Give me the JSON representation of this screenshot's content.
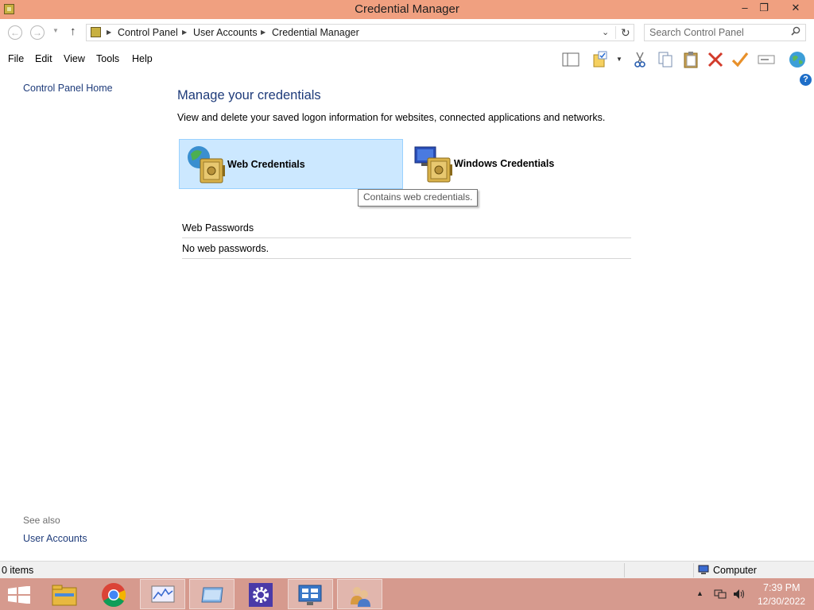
{
  "window": {
    "title": "Credential Manager"
  },
  "controls": {
    "minimize": "–",
    "maximize": "❐",
    "close": "✕"
  },
  "address": {
    "breadcrumbs": [
      "Control Panel",
      "User Accounts",
      "Credential Manager"
    ]
  },
  "search": {
    "placeholder": "Search Control Panel"
  },
  "menu": [
    "File",
    "Edit",
    "View",
    "Tools",
    "Help"
  ],
  "sidebar": {
    "home": "Control Panel Home",
    "see_also": "See also",
    "user_accounts": "User Accounts"
  },
  "main": {
    "title": "Manage your credentials",
    "description": "View and delete your saved logon information for websites, connected applications and networks.",
    "tiles": {
      "web": "Web Credentials",
      "windows": "Windows Credentials"
    },
    "tooltip": "Contains web credentials.",
    "section_header": "Web Passwords",
    "section_empty": "No web passwords."
  },
  "statusbar": {
    "items": "0 items",
    "location": "Computer"
  },
  "taskbar": {
    "time": "7:39 PM",
    "date": "12/30/2022",
    "buttons": [
      "start-button",
      "file-explorer",
      "chrome",
      "resource-monitor",
      "control-panel-window",
      "settings",
      "remote-desktop",
      "credential-manager"
    ]
  },
  "colors": {
    "titlebar": "#f0a080",
    "taskbar": "#d69a8e",
    "link": "#1e3b7a",
    "tile_selected": "#cce8ff"
  }
}
